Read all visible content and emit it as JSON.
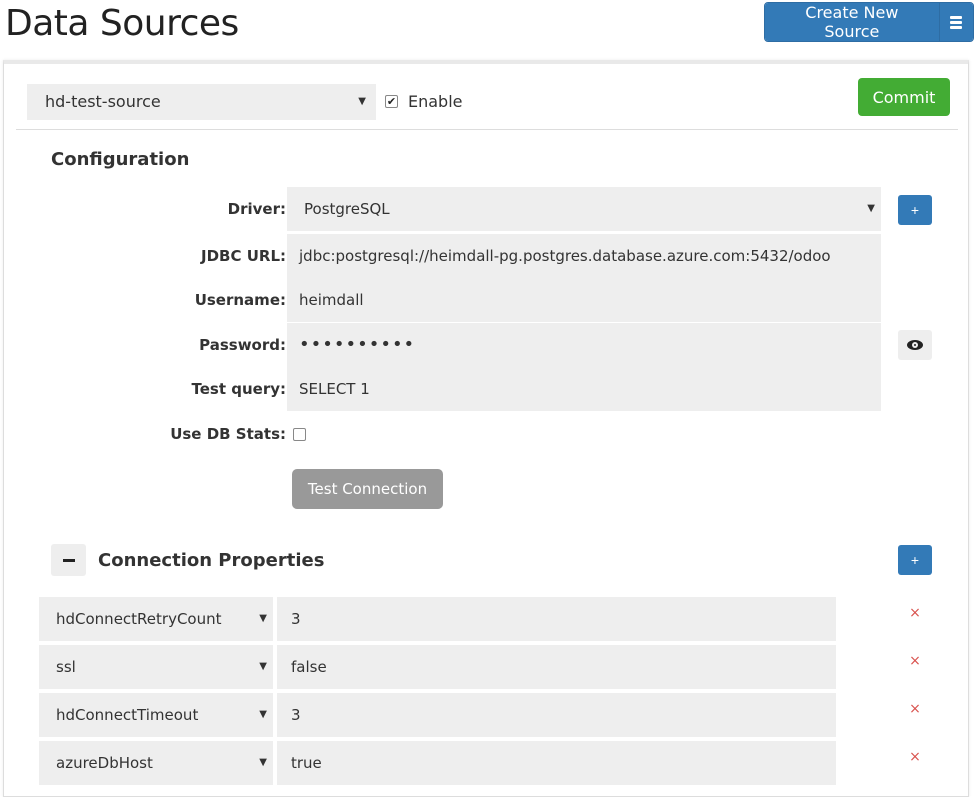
{
  "header": {
    "title": "Data Sources",
    "create_button": "Create New Source"
  },
  "toolbar": {
    "source_select": "hd-test-source",
    "enable_label": "Enable",
    "enable_checked": true,
    "commit_label": "Commit"
  },
  "config": {
    "title": "Configuration",
    "fields": {
      "driver": {
        "label": "Driver:",
        "value": "PostgreSQL"
      },
      "jdbc": {
        "label": "JDBC URL:",
        "value": "jdbc:postgresql://heimdall-pg.postgres.database.azure.com:5432/odoo"
      },
      "username": {
        "label": "Username:",
        "value": "heimdall"
      },
      "password": {
        "label": "Password:",
        "value": "••••••••••"
      },
      "test_query": {
        "label": "Test query:",
        "value": "SELECT 1"
      },
      "db_stats": {
        "label": "Use DB Stats:",
        "checked": false
      }
    },
    "test_button": "Test Connection",
    "add_button": "+"
  },
  "connection_properties": {
    "title": "Connection Properties",
    "add_button": "+",
    "rows": [
      {
        "key": "hdConnectRetryCount",
        "value": "3"
      },
      {
        "key": "ssl",
        "value": "false"
      },
      {
        "key": "hdConnectTimeout",
        "value": "3"
      },
      {
        "key": "azureDbHost",
        "value": "true"
      }
    ],
    "remove_symbol": "×"
  },
  "icons": {
    "caret": "▼",
    "menu": "hamburger-icon",
    "eye": "eye-icon",
    "collapse": "minus-icon"
  },
  "colors": {
    "primary": "#337ab7",
    "success": "#43ac34",
    "disabled": "#999999",
    "danger": "#d9534f",
    "field_bg": "#eeeeee"
  }
}
